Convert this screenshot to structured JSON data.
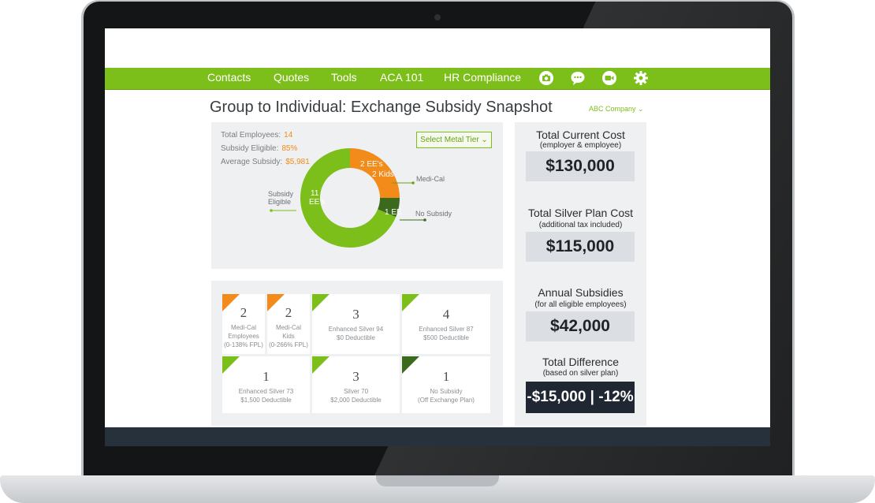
{
  "nav": {
    "items": [
      "Contacts",
      "Quotes",
      "Tools",
      "ACA 101",
      "HR Compliance"
    ],
    "icons": [
      "camera-icon",
      "chat-icon",
      "video-icon",
      "gear-icon"
    ],
    "color": "#7dbf1a"
  },
  "page": {
    "title": "Group to Individual: Exchange Subsidy Snapshot",
    "company": "ABC Company ⌄"
  },
  "summary": {
    "total_employees_label": "Total Employees:",
    "total_employees_value": "14",
    "subsidy_eligible_label": "Subsidy Eligible:",
    "subsidy_eligible_value": "85%",
    "average_subsidy_label": "Average Subsidy:",
    "average_subsidy_value": "$5,981",
    "metal_tier_button": "Select Metal Tier ⌄"
  },
  "donut": {
    "segments": [
      {
        "label_inner_1": "2 EE's",
        "label_inner_2": "2 Kids",
        "callout": "Medi-Cal",
        "value": 4,
        "color": "#f38b1b"
      },
      {
        "label_inner_1": "1 EE",
        "label_inner_2": "",
        "callout": "No Subsidy",
        "value": 1,
        "color": "#3c6a1d"
      },
      {
        "label_inner_1": "11",
        "label_inner_2": "EE's",
        "callout_1": "Subsidy",
        "callout_2": "Eligible",
        "value": 11,
        "color": "#7dbf1a"
      }
    ]
  },
  "cards": [
    {
      "num": "2",
      "lines": [
        "Medi-Cal",
        "Employees",
        "(0-138% FPL)"
      ],
      "color": "#f38b1b"
    },
    {
      "num": "2",
      "lines": [
        "Medi-Cal",
        "Kids",
        "(0-266% FPL)"
      ],
      "color": "#f38b1b"
    },
    {
      "num": "3",
      "lines": [
        "Enhanced Silver 94",
        "$0 Deductible"
      ],
      "color": "#7dbf1a"
    },
    {
      "num": "4",
      "lines": [
        "Enhanced Silver 87",
        "$500 Deductible"
      ],
      "color": "#7dbf1a"
    },
    {
      "num": "1",
      "lines": [
        "Enhanced Silver 73",
        "$1,500 Deductible"
      ],
      "color": "#7dbf1a"
    },
    {
      "num": "3",
      "lines": [
        "Silver 70",
        "$2,000 Deductible"
      ],
      "color": "#7dbf1a"
    },
    {
      "num": "1",
      "lines": [
        "No Subsidy",
        "(Off Exchange Plan)"
      ],
      "color": "#3c6a1d"
    }
  ],
  "metrics": {
    "current": {
      "title": "Total Current Cost",
      "sub": "(employer & employee)",
      "value": "$130,000"
    },
    "silver": {
      "title": "Total Silver Plan Cost",
      "sub": "(additional tax included)",
      "value": "$115,000"
    },
    "subsidies": {
      "title": "Annual Subsidies",
      "sub": "(for all eligible employees)",
      "value": "$42,000"
    },
    "difference": {
      "title": "Total Difference",
      "sub": "(based on silver plan)",
      "value": "-$15,000 | -12%"
    }
  }
}
